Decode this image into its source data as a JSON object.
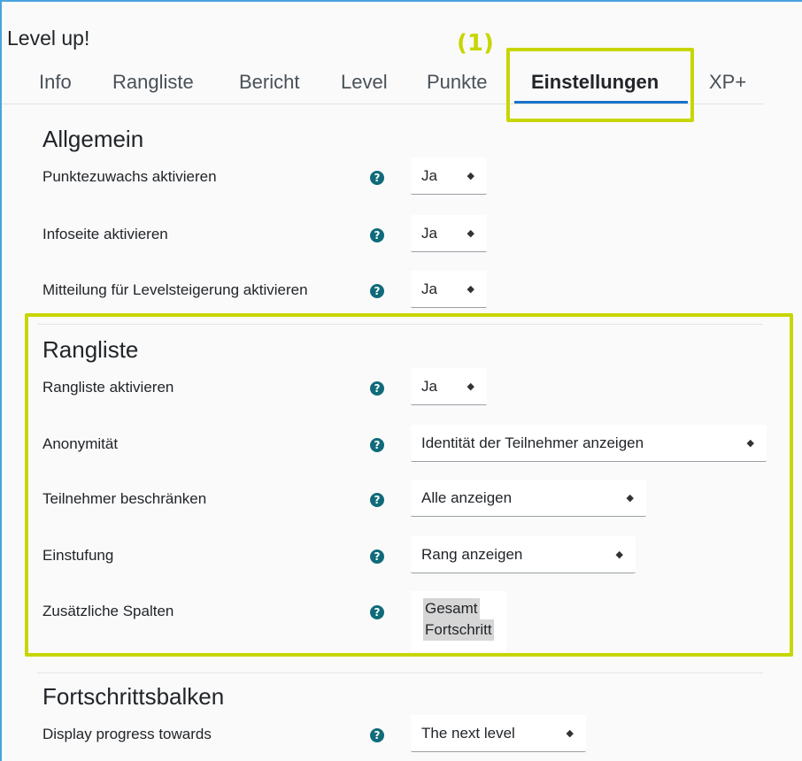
{
  "page": {
    "title": "Level up!"
  },
  "annotation": {
    "label": "(1)",
    "color": "#c7d600"
  },
  "tabs": [
    {
      "label": "Info"
    },
    {
      "label": "Rangliste"
    },
    {
      "label": "Bericht"
    },
    {
      "label": "Level"
    },
    {
      "label": "Punkte"
    },
    {
      "label": "Einstellungen",
      "active": true
    },
    {
      "label": "XP+"
    }
  ],
  "sections": {
    "general": {
      "title": "Allgemein",
      "rows": [
        {
          "label": "Punktezuwachs aktivieren",
          "value": "Ja"
        },
        {
          "label": "Infoseite aktivieren",
          "value": "Ja"
        },
        {
          "label": "Mitteilung für Levelsteigerung aktivieren",
          "value": "Ja"
        }
      ]
    },
    "ranking": {
      "title": "Rangliste",
      "rows": [
        {
          "label": "Rangliste aktivieren",
          "value": "Ja"
        },
        {
          "label": "Anonymität",
          "value": "Identität der Teilnehmer anzeigen"
        },
        {
          "label": "Teilnehmer beschränken",
          "value": "Alle anzeigen"
        },
        {
          "label": "Einstufung",
          "value": "Rang anzeigen"
        },
        {
          "label": "Zusätzliche Spalten",
          "options": [
            "Gesamt",
            "Fortschritt"
          ]
        }
      ]
    },
    "progress": {
      "title": "Fortschrittsbalken",
      "rows": [
        {
          "label": "Display progress towards",
          "value": "The next level"
        }
      ]
    }
  },
  "icons": {
    "help": "question-circle-icon",
    "select_arrow": "sort-arrows-icon"
  },
  "colors": {
    "accent": "#1a73c9",
    "help_icon": "#0f6b7a",
    "highlight": "#c7d600",
    "frame": "#4aa3df"
  }
}
